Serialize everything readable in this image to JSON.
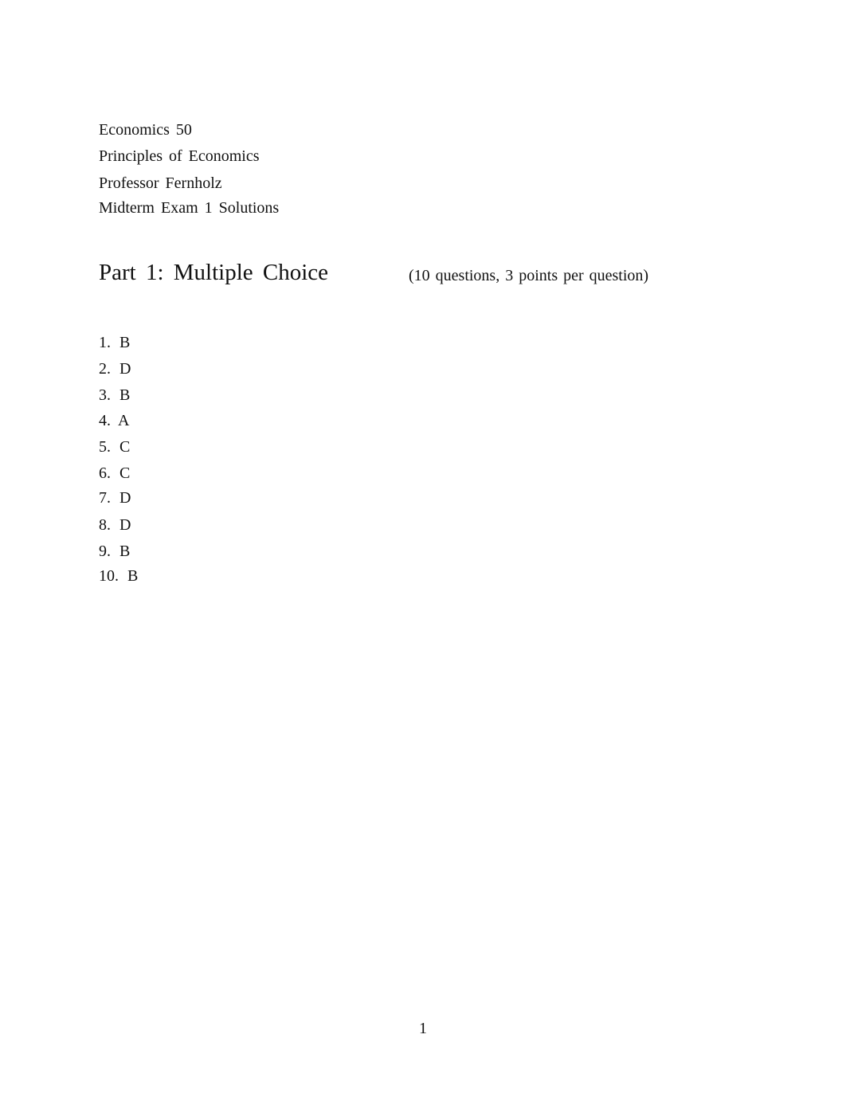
{
  "header": {
    "course": "Economics 50",
    "course_title": "Principles of Economics",
    "professor": "Professor Fernholz",
    "document_title": "Midterm Exam 1 Solutions"
  },
  "part1": {
    "title": "Part 1: Multiple Choice",
    "note": "(10 questions, 3 points per question)",
    "answers": [
      {
        "number": "1.",
        "answer": "B"
      },
      {
        "number": "2.",
        "answer": "D"
      },
      {
        "number": "3.",
        "answer": "B"
      },
      {
        "number": "4.",
        "answer": "A"
      },
      {
        "number": "5.",
        "answer": "C"
      },
      {
        "number": "6.",
        "answer": "C"
      },
      {
        "number": "7.",
        "answer": "D"
      },
      {
        "number": "8.",
        "answer": "D"
      },
      {
        "number": "9.",
        "answer": "B"
      },
      {
        "number": "10.",
        "answer": "B"
      }
    ]
  },
  "footer": {
    "page_number": "1"
  }
}
